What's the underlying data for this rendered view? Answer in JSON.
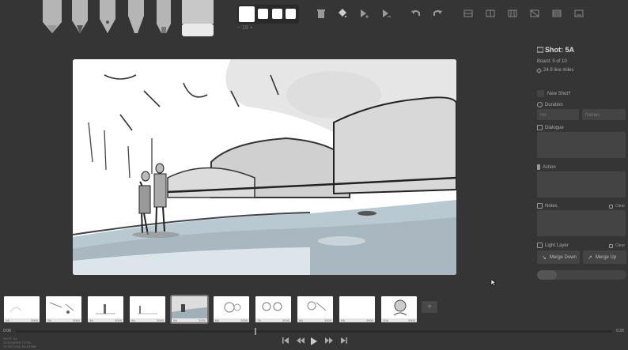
{
  "toolbar": {
    "tools": [
      "light-pencil",
      "pencil",
      "pen",
      "brush",
      "note-pen",
      "eraser"
    ],
    "brush_size": "− 19 +",
    "buttons": [
      "trash",
      "fill",
      "add-shot",
      "remove-shot",
      "undo",
      "redo"
    ],
    "right_buttons": [
      "grid",
      "center",
      "thirds",
      "perspective",
      "layers",
      "caption"
    ]
  },
  "panel": {
    "title": "Shot: 5A",
    "board": "Board: 5 of 10",
    "lines": "24.9 line miles",
    "new_shot": "New Shot?",
    "duration_label": "Duration",
    "duration_ms_placeholder": "ms",
    "duration_frames_placeholder": "frames",
    "dialogue_label": "Dialogue",
    "action_label": "Action",
    "notes_label": "Notes",
    "notes_clear": "Clear",
    "light_layer_label": "Light Layer",
    "light_layer_clear": "Clear",
    "merge_down": "Merge Down",
    "merge_up": "Merge Up",
    "light_layer_opacity": 0.22
  },
  "timeline": {
    "thumbs": [
      {
        "shot": "1A",
        "dur": "2000"
      },
      {
        "shot": "2A",
        "dur": "2000"
      },
      {
        "shot": "3A",
        "dur": "2000"
      },
      {
        "shot": "4A",
        "dur": "2000"
      },
      {
        "shot": "5A",
        "dur": "2000"
      },
      {
        "shot": "6A",
        "dur": "2000"
      },
      {
        "shot": "7A",
        "dur": "2000"
      },
      {
        "shot": "8A",
        "dur": "2000"
      },
      {
        "shot": "9A",
        "dur": "2000"
      },
      {
        "shot": "10A",
        "dur": "2000"
      }
    ],
    "add_label": "+",
    "time_start": "0:08",
    "time_end": "0:20",
    "playhead": 0.4
  },
  "info": {
    "line1": "SHOT: 5A",
    "line2": "10 BOARDS TOTAL",
    "line3": "20 SECOND RUNTIME"
  }
}
